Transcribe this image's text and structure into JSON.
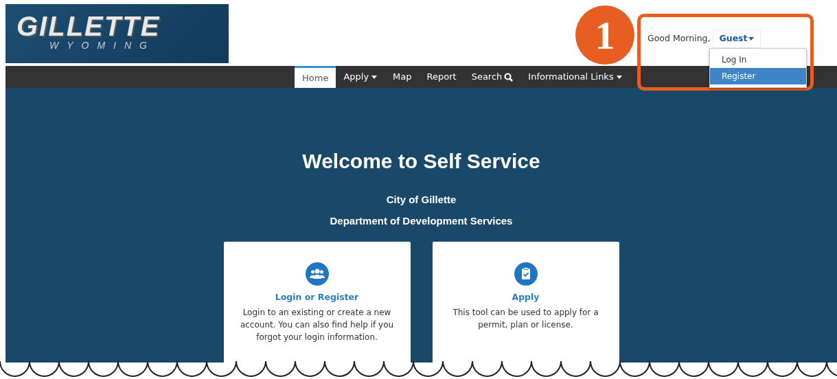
{
  "logo": {
    "title": "GILLETTE",
    "subtitle": "WYOMING"
  },
  "nav": [
    {
      "label": "Home",
      "selected": true,
      "caret": false,
      "kind": "text"
    },
    {
      "label": "Apply",
      "selected": false,
      "caret": true,
      "kind": "text"
    },
    {
      "label": "Map",
      "selected": false,
      "caret": false,
      "kind": "text"
    },
    {
      "label": "Report",
      "selected": false,
      "caret": false,
      "kind": "text"
    },
    {
      "label": "Search",
      "selected": false,
      "caret": false,
      "kind": "search"
    },
    {
      "label": "Informational Links",
      "selected": false,
      "caret": true,
      "kind": "text"
    }
  ],
  "user": {
    "greeting": "Good Morning,",
    "name": "Guest",
    "expanded": true,
    "menu": [
      {
        "label": "Log In",
        "selected": false
      },
      {
        "label": "Register",
        "selected": true
      }
    ]
  },
  "callout": {
    "number": "1"
  },
  "hero": {
    "title": "Welcome to Self Service",
    "lines": [
      "City of Gillette",
      "Department of Development Services"
    ]
  },
  "cards": [
    {
      "kind": "people",
      "title": "Login or Register",
      "text": "Login to an existing or create a new account. You can also find help if you forgot your login information."
    },
    {
      "kind": "clipboard",
      "title": "Apply",
      "text": "This tool can be used to apply for a permit, plan or license."
    }
  ]
}
